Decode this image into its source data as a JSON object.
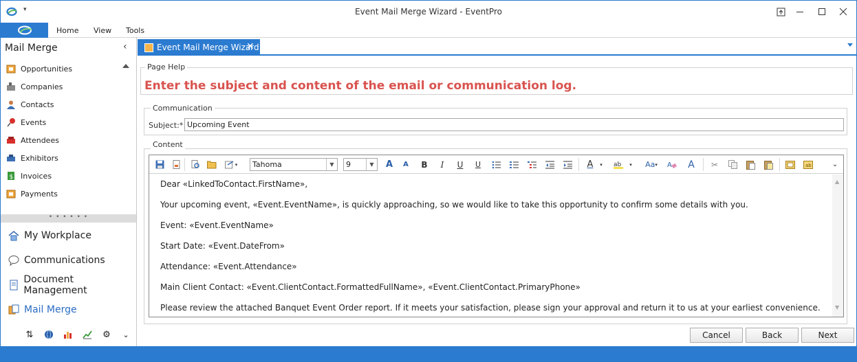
{
  "window": {
    "title": "Event Mail Merge Wizard - EventPro",
    "accent_color": "#2b7bd0"
  },
  "ribbon": {
    "tabs": [
      "Home",
      "View",
      "Tools"
    ]
  },
  "nav": {
    "header": "Mail Merge",
    "items": [
      {
        "label": "Opportunities",
        "icon": "opportunities-icon"
      },
      {
        "label": "Companies",
        "icon": "companies-icon"
      },
      {
        "label": "Contacts",
        "icon": "contacts-icon"
      },
      {
        "label": "Events",
        "icon": "events-pin-icon"
      },
      {
        "label": "Attendees",
        "icon": "attendees-icon"
      },
      {
        "label": "Exhibitors",
        "icon": "exhibitors-icon"
      },
      {
        "label": "Invoices",
        "icon": "invoices-icon"
      },
      {
        "label": "Payments",
        "icon": "payments-icon"
      }
    ],
    "splitter_grip": "• • • • • •",
    "workspaces": [
      {
        "label": "My Workplace",
        "icon": "house-icon",
        "active": false
      },
      {
        "label": "Communications",
        "icon": "speech-bubble-icon",
        "active": false
      },
      {
        "label": "Document Management",
        "icon": "document-icon",
        "active": false
      },
      {
        "label": "Mail Merge",
        "icon": "mail-merge-icon",
        "active": true
      }
    ]
  },
  "doc_tab": {
    "label": "Event Mail Merge Wizard",
    "close": "✕"
  },
  "page_help": {
    "group_label": "Page Help",
    "text": "Enter the subject and content of the email or communication log.",
    "text_color": "#d9534f"
  },
  "communication": {
    "group_label": "Communication",
    "subject_label": "Subject:*",
    "subject_value": "Upcoming Event"
  },
  "content": {
    "group_label": "Content",
    "font_name": "Tahoma",
    "font_size": "9",
    "paragraphs": [
      "Dear «LinkedToContact.FirstName»,",
      "Your upcoming event, «Event.EventName», is quickly approaching, so we would like to take this opportunity to confirm some details with you.",
      "Event: «Event.EventName»",
      "Start Date: «Event.DateFrom»",
      "Attendance: «Event.Attendance»",
      "Main Client Contact: «Event.ClientContact.FormattedFullName», «Event.ClientContact.PrimaryPhone»",
      "Please review the attached Banquet Event Order report. If it meets your satisfaction, please sign your approval and return it to us at your earliest convenience."
    ]
  },
  "buttons": {
    "cancel": "Cancel",
    "back": "Back",
    "next": "Next"
  }
}
